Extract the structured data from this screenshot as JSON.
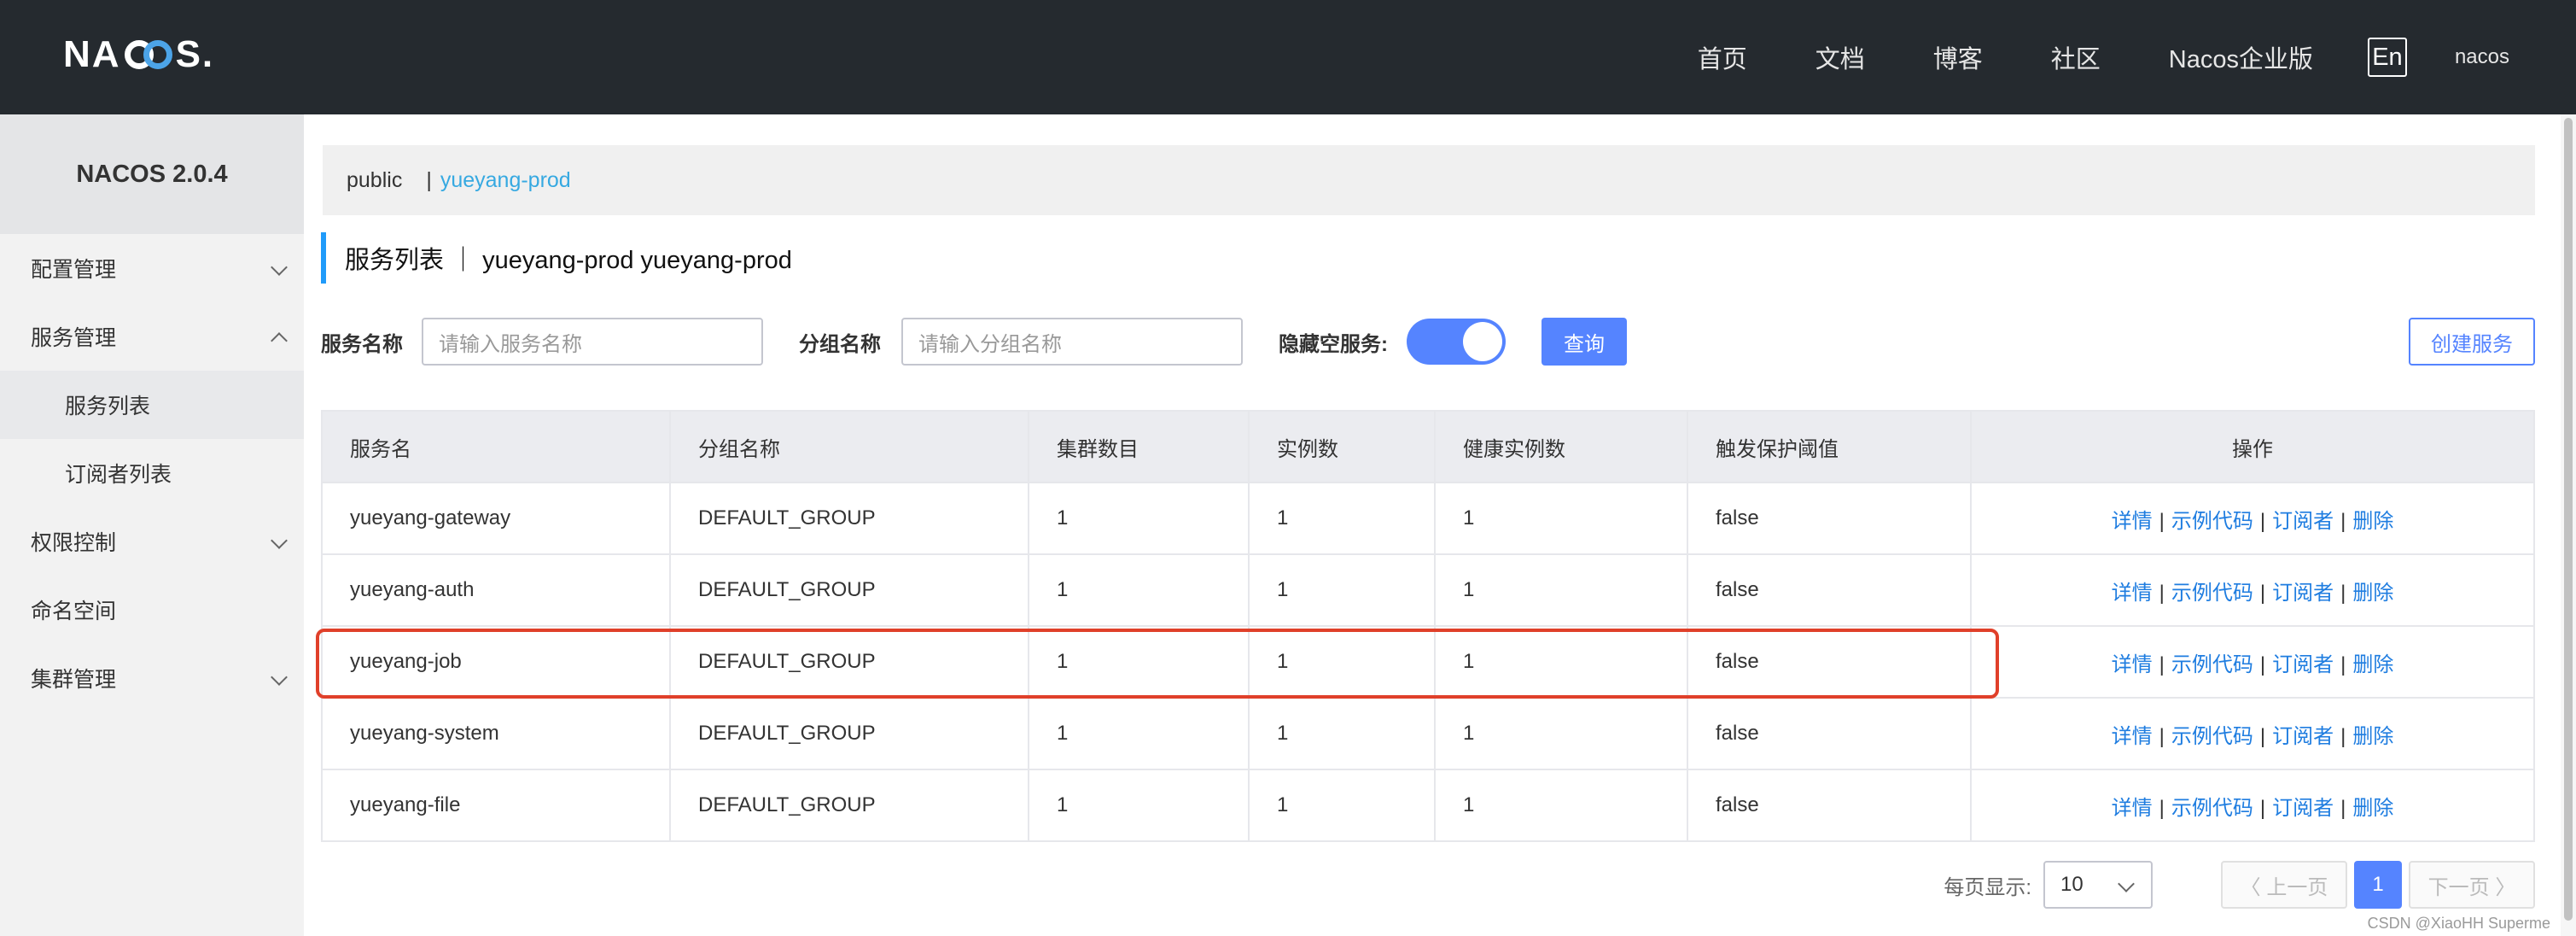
{
  "header": {
    "logo_text": "NACOS.",
    "nav": [
      "首页",
      "文档",
      "博客",
      "社区",
      "Nacos企业版"
    ],
    "lang": "En",
    "user": "nacos"
  },
  "sidebar": {
    "version": "NACOS 2.0.4",
    "items": [
      {
        "label": "配置管理",
        "icon": "chevron-down-icon"
      },
      {
        "label": "服务管理",
        "icon": "chevron-up-icon"
      },
      {
        "label": "服务列表"
      },
      {
        "label": "订阅者列表"
      },
      {
        "label": "权限控制",
        "icon": "chevron-down-icon"
      },
      {
        "label": "命名空间"
      },
      {
        "label": "集群管理",
        "icon": "chevron-down-icon"
      }
    ]
  },
  "breadcrumb": {
    "namespace": "public",
    "separator": "|",
    "current": "yueyang-prod"
  },
  "page": {
    "title": "服务列表 ｜ yueyang-prod  yueyang-prod"
  },
  "filters": {
    "service_label": "服务名称",
    "service_placeholder": "请输入服务名称",
    "group_label": "分组名称",
    "group_placeholder": "请输入分组名称",
    "hide_empty_label": "隐藏空服务:",
    "hide_empty_on": true,
    "query_button": "查询",
    "create_button": "创建服务"
  },
  "table": {
    "headers": [
      "服务名",
      "分组名称",
      "集群数目",
      "实例数",
      "健康实例数",
      "触发保护阈值",
      "操作"
    ],
    "actions": [
      "详情",
      "示例代码",
      "订阅者",
      "删除"
    ],
    "rows": [
      [
        "yueyang-gateway",
        "DEFAULT_GROUP",
        "1",
        "1",
        "1",
        "false"
      ],
      [
        "yueyang-auth",
        "DEFAULT_GROUP",
        "1",
        "1",
        "1",
        "false"
      ],
      [
        "yueyang-job",
        "DEFAULT_GROUP",
        "1",
        "1",
        "1",
        "false"
      ],
      [
        "yueyang-system",
        "DEFAULT_GROUP",
        "1",
        "1",
        "1",
        "false"
      ],
      [
        "yueyang-file",
        "DEFAULT_GROUP",
        "1",
        "1",
        "1",
        "false"
      ]
    ]
  },
  "pagination": {
    "page_size_label": "每页显示:",
    "page_size": "10",
    "prev": "〈 上一页",
    "current_page": "1",
    "next": "下一页 〉"
  },
  "watermark": "CSDN @XiaoHH Superme",
  "colors": {
    "topbar": "#252a2f",
    "primary": "#5584ff",
    "link": "#1f7de0",
    "highlight": "#e0402a"
  }
}
